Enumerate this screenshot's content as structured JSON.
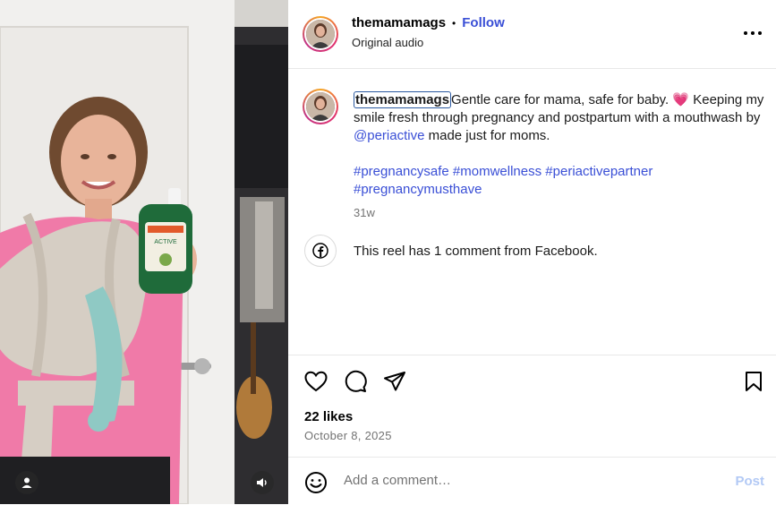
{
  "post": {
    "username": "themamamags",
    "separator": "•",
    "follow_label": "Follow",
    "audio": "Original audio",
    "more_icon": "more-horizontal-icon"
  },
  "caption": {
    "username": "themamamags",
    "text_1": "Gentle care for mama, safe for baby. 💗 Keeping my smile fresh through pregnancy and postpartum with a mouthwash by ",
    "mention": "@periactive",
    "text_2": " made just for moms.",
    "hashtags": [
      "#pregnancysafe",
      "#momwellness",
      "#periactivepartner",
      "#pregnancymusthave"
    ],
    "age": "31w"
  },
  "facebook_note": {
    "icon": "facebook-icon",
    "text": "This reel has 1 comment from Facebook."
  },
  "actions": {
    "like_icon": "heart-icon",
    "comment_icon": "comment-icon",
    "share_icon": "share-icon",
    "save_icon": "bookmark-icon"
  },
  "stats": {
    "likes": "22 likes",
    "date": "October 8, 2025"
  },
  "comment": {
    "emoji_icon": "emoji-icon",
    "placeholder": "Add a comment…",
    "post_label": "Post"
  },
  "media": {
    "product_label": "ACTIVE",
    "user_icon": "person-icon",
    "audio_icon": "speaker-icon"
  },
  "colors": {
    "accent": "#3a4fd6",
    "post_disabled": "#b2c9f5",
    "shirt": "#f07aa8",
    "wrap": "#d6cec4",
    "bottle": "#1f6b3a"
  }
}
